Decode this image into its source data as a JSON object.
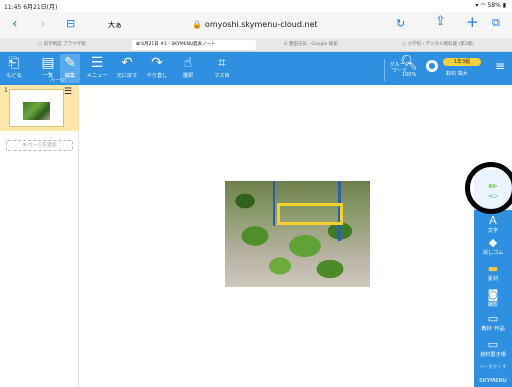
{
  "status": {
    "time": "11:45  6月21日(月)",
    "battery": "58%"
  },
  "browser": {
    "reader": "大ぁ",
    "url": "omyoshi.skymenu-cloud.net",
    "tabs": [
      {
        "label": "就学制度 ブラウザ版",
        "active": false
      },
      {
        "label": "6月21日 #1 - SKYMENU発表ノート",
        "active": true
      },
      {
        "label": "豊田天気 - Google 検索",
        "active": false
      },
      {
        "label": "小学校・デジタル教科書 (第3版)",
        "active": false
      }
    ]
  },
  "toolbar": {
    "back": "もどる",
    "page_list": "一覧",
    "page_edit": "編集",
    "page": "ページ",
    "menu": "メニュー",
    "undo": "元に戻す",
    "redo": "やり直し",
    "select": "選択",
    "grid": "マス目",
    "group": "グループ\nワーク",
    "zoom": "100%",
    "class_label": "1年3組",
    "user": "鈴石 祐大"
  },
  "left_panel": {
    "page_number": "1",
    "add_page": "ページを追加"
  },
  "sidebar": {
    "items": [
      {
        "label": "ペン",
        "icon": "pen-icon"
      },
      {
        "label": "文字",
        "icon": "text-icon"
      },
      {
        "label": "消しゴム",
        "icon": "eraser-icon"
      },
      {
        "label": "素材",
        "icon": "folder-icon"
      },
      {
        "label": "撮影",
        "icon": "camera-icon"
      },
      {
        "label": "教材･作品",
        "icon": "folder-icon"
      },
      {
        "label": "資料置き場",
        "icon": "book-icon"
      },
      {
        "label": "バーをかくす",
        "icon": "hide-icon"
      }
    ],
    "brand": "SKYMENU"
  },
  "colors": {
    "toolbar": "#2f8fe0",
    "highlight": "#fce7a8",
    "accent_ring": "#000000"
  }
}
